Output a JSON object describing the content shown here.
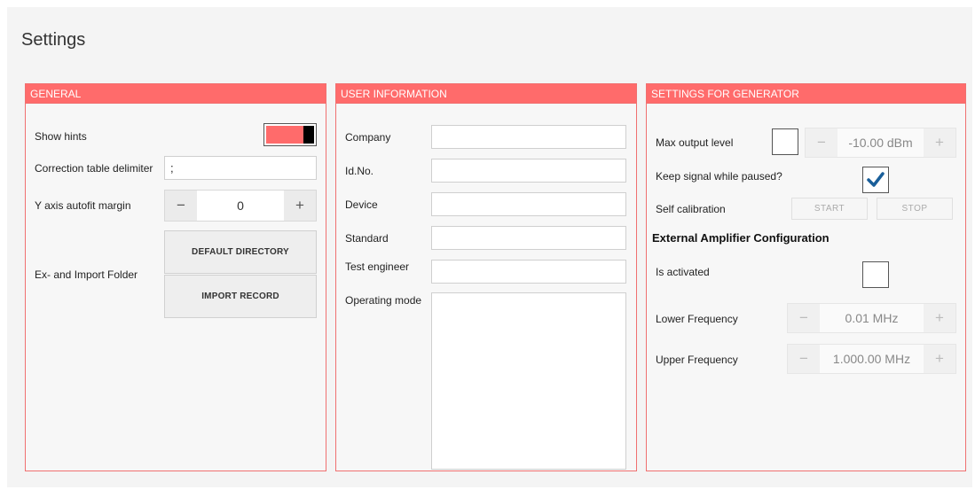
{
  "window": {
    "title": "Settings"
  },
  "general": {
    "header": "GENERAL",
    "show_hints_label": "Show hints",
    "delimiter_label": "Correction table delimiter",
    "delimiter_value": ";",
    "yaxis_label": "Y axis autofit margin",
    "yaxis_value": "0",
    "folder_label": "Ex- and Import Folder",
    "default_dir_button": "DEFAULT DIRECTORY",
    "import_record_button": "IMPORT RECORD",
    "minus": "−",
    "plus": "+"
  },
  "user": {
    "header": "USER INFORMATION",
    "company_label": "Company",
    "idno_label": "Id.No.",
    "device_label": "Device",
    "standard_label": "Standard",
    "engineer_label": "Test engineer",
    "mode_label": "Operating mode",
    "company_value": "",
    "idno_value": "",
    "device_value": "",
    "standard_value": "",
    "engineer_value": "",
    "mode_value": ""
  },
  "generator": {
    "header": "SETTINGS FOR GENERATOR",
    "max_output_label": "Max output level",
    "max_output_value": "-10.00 dBm",
    "keep_signal_label": "Keep signal while paused?",
    "self_cal_label": "Self calibration",
    "start_button": "START",
    "stop_button": "STOP",
    "ext_amp_title": "External Amplifier Configuration",
    "activated_label": "Is activated",
    "lower_freq_label": "Lower Frequency",
    "lower_freq_value": "0.01 MHz",
    "upper_freq_label": "Upper Frequency",
    "upper_freq_value": "1.000.00 MHz",
    "minus": "−",
    "plus": "+"
  },
  "colors": {
    "accent": "#ff6b6b",
    "check": "#1a5f9a"
  }
}
